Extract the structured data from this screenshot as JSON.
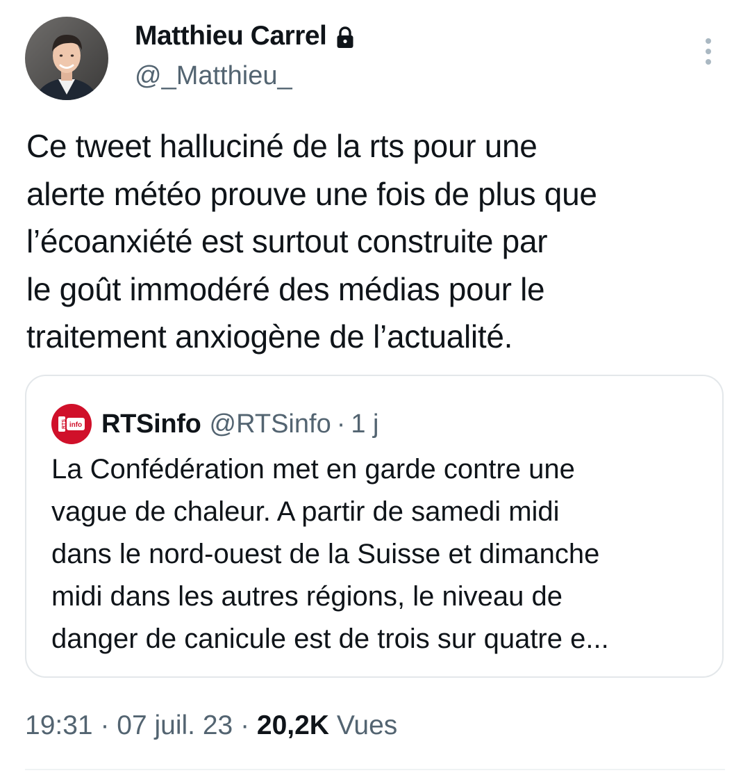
{
  "author": {
    "name": "Matthieu Carrel",
    "handle": "@_Matthieu_",
    "protected_icon": "lock-icon",
    "avatar": "avatar-photo"
  },
  "more_icon": "vertical-ellipsis-icon",
  "tweet": {
    "text": "Ce tweet halluciné de la rts pour une\nalerte météo prouve une fois de plus que\nl’écoanxiété est surtout construite par\nle goût immodéré des médias pour le\ntraitement anxiogène de l’actualité."
  },
  "quoted": {
    "logo": "rts-info-logo",
    "logo_text": "RTS Info",
    "name": "RTSinfo",
    "handle": "@RTSinfo",
    "separator": "·",
    "time": "1 j",
    "text": "La Confédération met en garde contre une\nvague de chaleur. A partir de samedi midi\ndans le nord-ouest de la Suisse et dimanche\nmidi dans les autres régions, le niveau de\ndanger de canicule est de trois sur quatre e..."
  },
  "meta": {
    "time": "19:31",
    "sep1": " · ",
    "date": "07 juil. 23",
    "sep2": " · ",
    "views_count": "20,2K",
    "views_label": " Vues"
  },
  "colors": {
    "text": "#0f1419",
    "secondary": "#536471",
    "border": "#e3e7ea",
    "rts_red": "#d0102a"
  }
}
